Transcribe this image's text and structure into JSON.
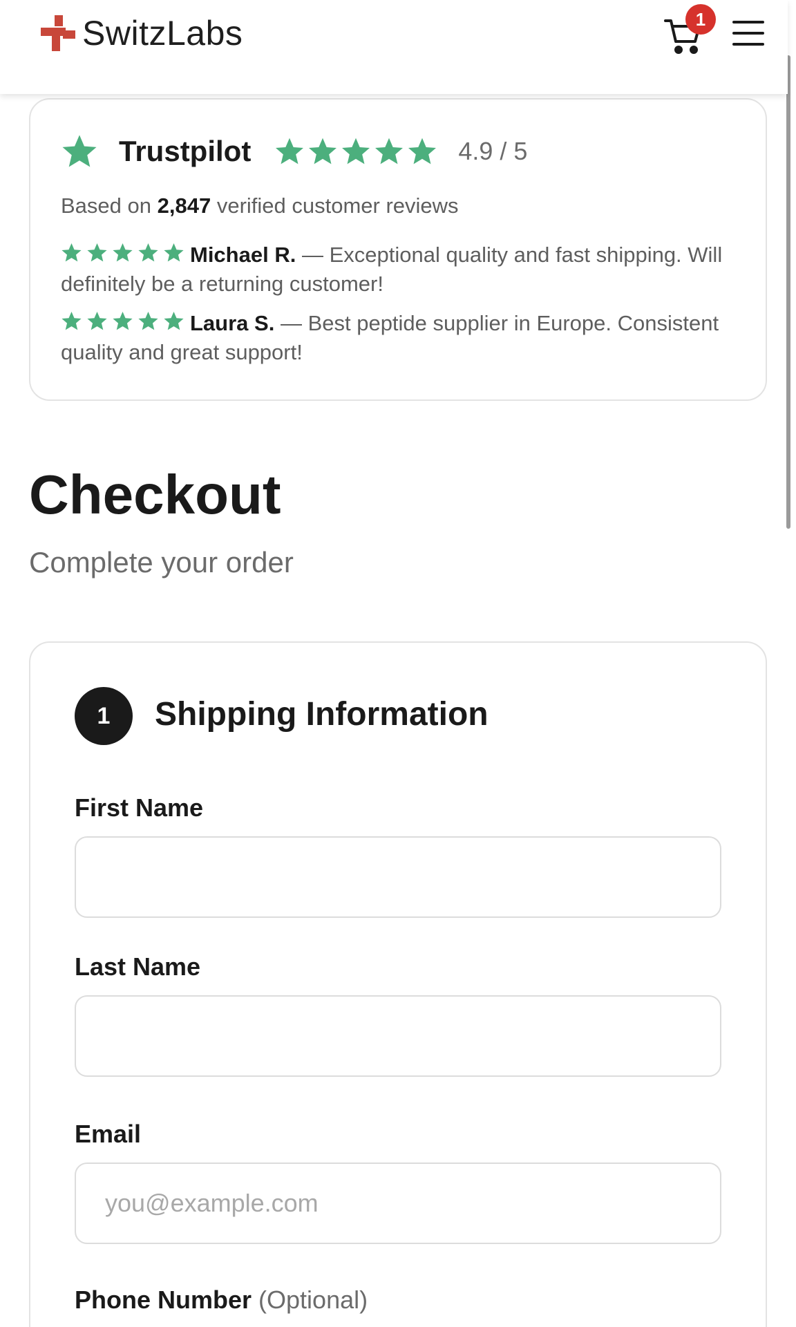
{
  "header": {
    "brand": "SwitzLabs",
    "cart_count": "1",
    "brand_color": "#c8473a"
  },
  "trust": {
    "name": "Trustpilot",
    "score": "4.9 / 5",
    "rating_stars": 5,
    "star_color": "#4caf7d",
    "based_prefix": "Based on",
    "based_count": "2,847",
    "based_suffix": "verified customer reviews",
    "reviews": [
      {
        "author": "Michael R.",
        "text": "— Exceptional quality and fast shipping. Will definitely be a returning customer!"
      },
      {
        "author": "Laura S.",
        "text": "— Best peptide supplier in Europe. Consistent quality and great support!"
      }
    ]
  },
  "checkout": {
    "title": "Checkout",
    "subtitle": "Complete your order"
  },
  "shipping": {
    "step_number": "1",
    "title": "Shipping Information",
    "fields": {
      "first_name": {
        "label": "First Name",
        "value": "",
        "placeholder": ""
      },
      "last_name": {
        "label": "Last Name",
        "value": "",
        "placeholder": ""
      },
      "email": {
        "label": "Email",
        "value": "",
        "placeholder": "you@example.com"
      },
      "phone": {
        "label": "Phone Number",
        "optional": "(Optional)"
      }
    }
  }
}
